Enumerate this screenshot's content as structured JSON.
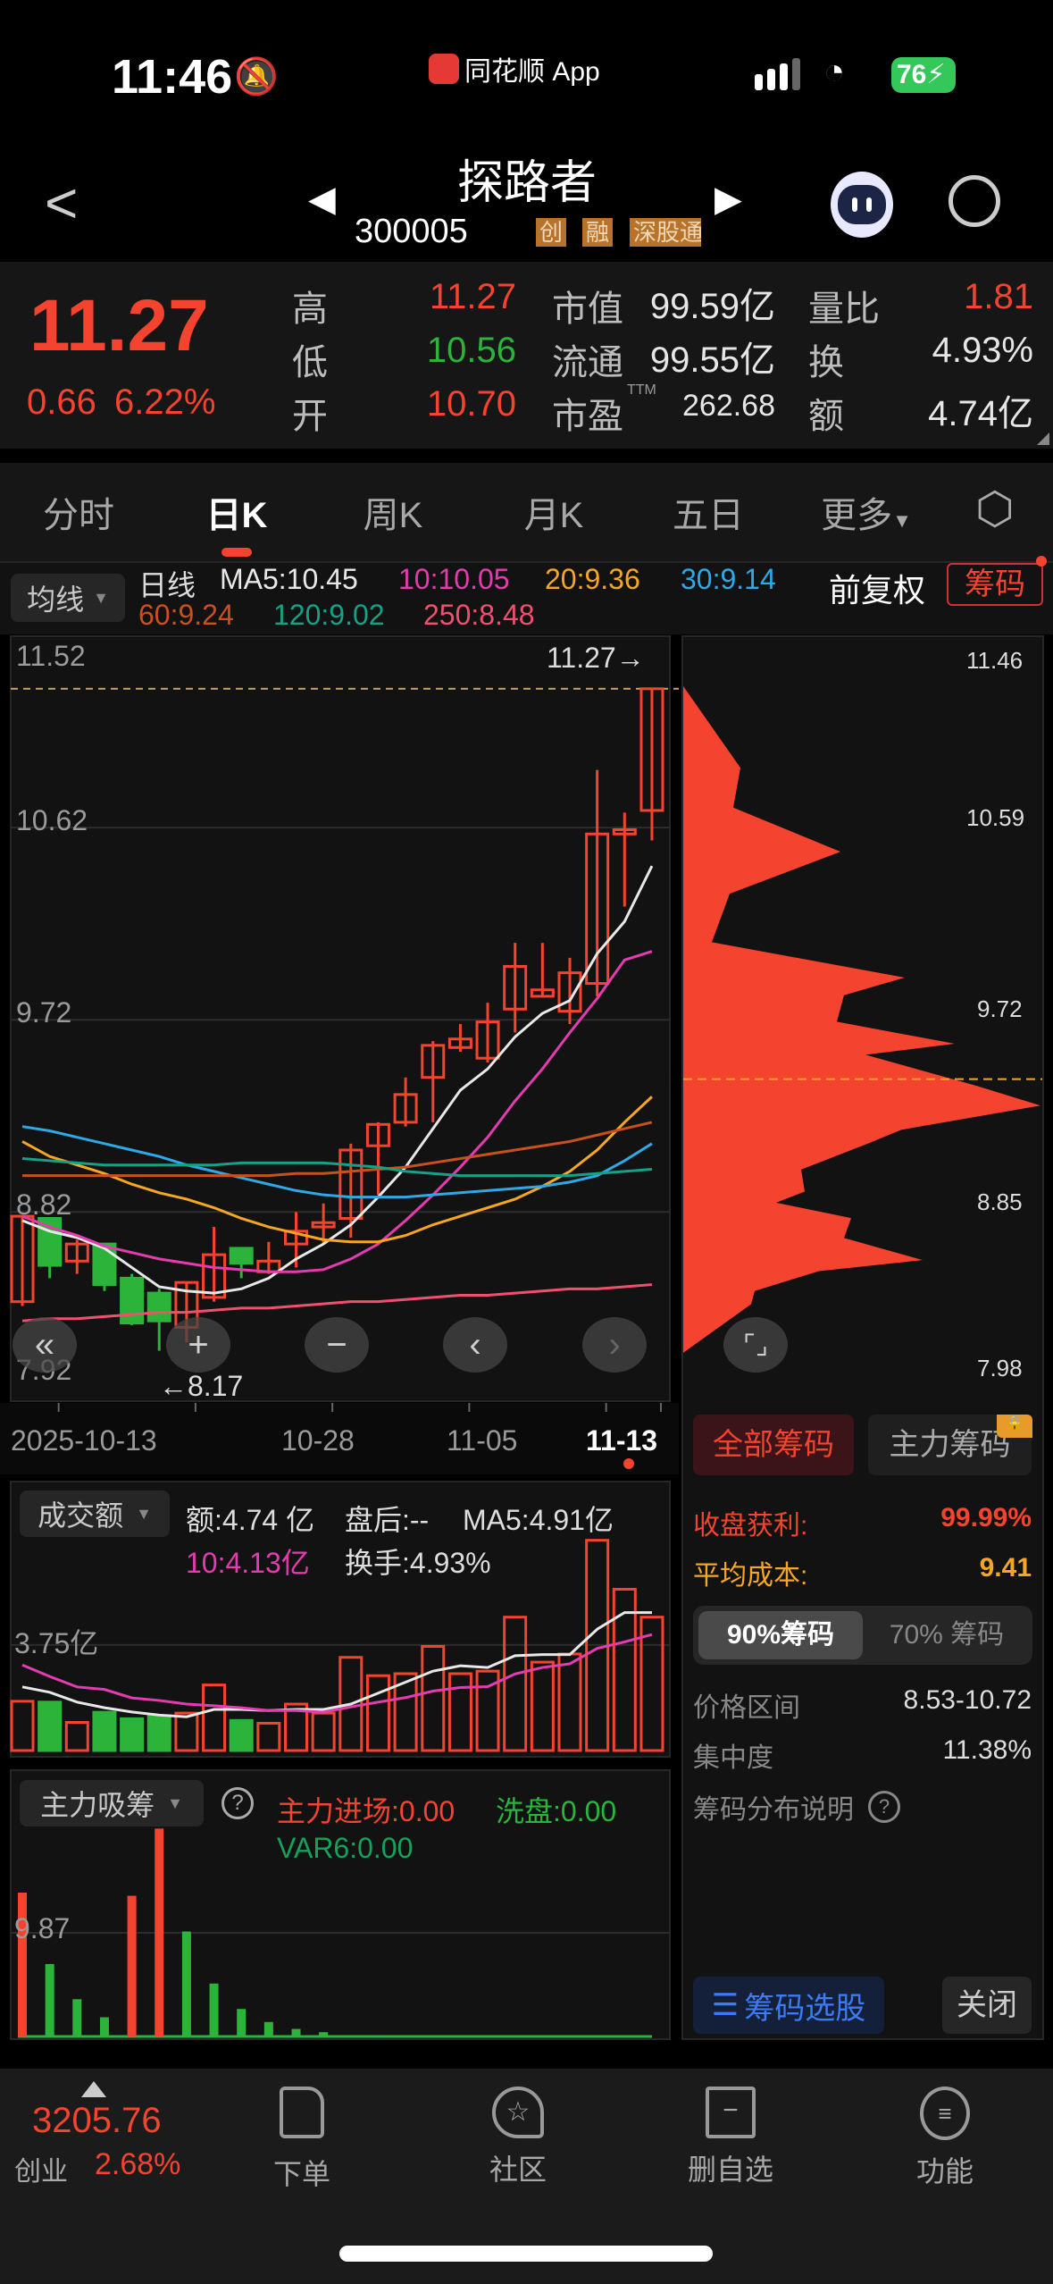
{
  "status": {
    "time": "11:46",
    "app": "同花顺 App",
    "battery": "76"
  },
  "header": {
    "title": "探路者",
    "code": "300005",
    "badges": [
      "创",
      "融",
      "深股通"
    ]
  },
  "quote": {
    "price": "11.27",
    "change": "0.66",
    "change_pct": "6.22%",
    "high_label": "高",
    "high": "11.27",
    "low_label": "低",
    "low": "10.56",
    "open_label": "开",
    "open": "10.70",
    "mcap_label": "市值",
    "mcap": "99.59亿",
    "float_label": "流通",
    "float": "99.55亿",
    "pe_label": "市盈",
    "pe_sup": "TTM",
    "pe": "262.68",
    "vr_label": "量比",
    "vr": "1.81",
    "turn_label": "换",
    "turn": "4.93%",
    "amt_label": "额",
    "amt": "4.74亿"
  },
  "tabs": [
    "分时",
    "日K",
    "周K",
    "月K",
    "五日",
    "更多"
  ],
  "legend": {
    "selector": "均线",
    "period": "日线",
    "ma5": "MA5:10.45",
    "ma10": "10:10.05",
    "ma20": "20:9.36",
    "ma30": "30:9.14",
    "ma60": "60:9.24",
    "ma120": "120:9.02",
    "ma250": "250:8.48",
    "adjust": "前复权",
    "chips": "筹码"
  },
  "colors": {
    "up": "#f4432f",
    "down": "#2bb33a",
    "ma5": "#e8e8e8",
    "ma10": "#e43cb0",
    "ma20": "#f5a623",
    "ma30": "#2fa8e8",
    "ma60": "#c8501e",
    "ma120": "#17a085",
    "ma250": "#f0506e"
  },
  "chart_data": [
    {
      "type": "candlestick",
      "title": "日K",
      "yticks": [
        "11.52",
        "10.62",
        "9.72",
        "8.82",
        "7.92"
      ],
      "ylim": [
        7.92,
        11.52
      ],
      "last_label": "11.27→",
      "low_label": "←8.17",
      "xticks": [
        "2025-10-13",
        "10-28",
        "11-05",
        "11-13"
      ],
      "ohlc": [
        [
          8.4,
          8.8,
          8.38,
          8.8
        ],
        [
          8.79,
          8.79,
          8.51,
          8.57
        ],
        [
          8.59,
          8.69,
          8.53,
          8.67
        ],
        [
          8.67,
          8.67,
          8.45,
          8.48
        ],
        [
          8.51,
          8.53,
          8.29,
          8.3
        ],
        [
          8.44,
          8.46,
          8.17,
          8.31
        ],
        [
          8.28,
          8.49,
          8.21,
          8.49
        ],
        [
          8.42,
          8.75,
          8.4,
          8.62
        ],
        [
          8.65,
          8.65,
          8.51,
          8.58
        ],
        [
          8.54,
          8.68,
          8.53,
          8.59
        ],
        [
          8.67,
          8.82,
          8.56,
          8.73
        ],
        [
          8.75,
          8.86,
          8.67,
          8.77
        ],
        [
          8.79,
          9.14,
          8.7,
          9.11
        ],
        [
          9.13,
          9.24,
          8.9,
          9.23
        ],
        [
          9.24,
          9.45,
          9.22,
          9.37
        ],
        [
          9.45,
          9.62,
          9.24,
          9.6
        ],
        [
          9.59,
          9.7,
          9.57,
          9.63
        ],
        [
          9.54,
          9.8,
          9.52,
          9.71
        ],
        [
          9.77,
          10.08,
          9.66,
          9.97
        ],
        [
          9.83,
          10.08,
          9.83,
          9.86
        ],
        [
          9.76,
          10.01,
          9.7,
          9.94
        ],
        [
          9.89,
          10.89,
          9.83,
          10.59
        ],
        [
          10.59,
          10.69,
          10.25,
          10.61
        ],
        [
          10.7,
          11.27,
          10.56,
          11.27
        ]
      ],
      "ma": {
        "ma5": [
          8.78,
          8.73,
          8.7,
          8.65,
          8.56,
          8.47,
          8.45,
          8.44,
          8.46,
          8.51,
          8.6,
          8.67,
          8.76,
          8.89,
          9.03,
          9.21,
          9.39,
          9.49,
          9.64,
          9.75,
          9.81,
          10.03,
          10.18,
          10.44
        ],
        "ma10": [
          8.8,
          8.75,
          8.71,
          8.66,
          8.63,
          8.6,
          8.58,
          8.56,
          8.55,
          8.54,
          8.54,
          8.55,
          8.6,
          8.67,
          8.78,
          8.9,
          9.03,
          9.17,
          9.34,
          9.49,
          9.66,
          9.82,
          10.0,
          10.04
        ],
        "ma20": [
          9.15,
          9.08,
          9.04,
          9.0,
          8.95,
          8.91,
          8.88,
          8.84,
          8.79,
          8.75,
          8.72,
          8.69,
          8.68,
          8.68,
          8.71,
          8.76,
          8.8,
          8.84,
          8.88,
          8.94,
          9.01,
          9.11,
          9.24,
          9.36
        ],
        "ma30": [
          9.22,
          9.2,
          9.17,
          9.14,
          9.11,
          9.08,
          9.04,
          9.01,
          8.98,
          8.95,
          8.92,
          8.9,
          8.89,
          8.89,
          8.89,
          8.9,
          8.91,
          8.92,
          8.93,
          8.94,
          8.96,
          8.99,
          9.06,
          9.14
        ],
        "ma60": [
          8.99,
          8.99,
          8.99,
          8.99,
          8.99,
          8.99,
          8.99,
          8.99,
          8.99,
          8.99,
          9.0,
          9.0,
          9.01,
          9.02,
          9.03,
          9.05,
          9.07,
          9.09,
          9.11,
          9.13,
          9.15,
          9.18,
          9.21,
          9.24
        ],
        "ma120": [
          9.07,
          9.06,
          9.05,
          9.04,
          9.04,
          9.04,
          9.04,
          9.04,
          9.05,
          9.05,
          9.05,
          9.05,
          9.04,
          9.03,
          9.01,
          9.0,
          8.99,
          8.99,
          8.99,
          8.99,
          8.99,
          9.0,
          9.01,
          9.02
        ],
        "ma250": [
          8.31,
          8.32,
          8.32,
          8.33,
          8.34,
          8.35,
          8.35,
          8.36,
          8.37,
          8.37,
          8.38,
          8.39,
          8.4,
          8.4,
          8.41,
          8.42,
          8.43,
          8.43,
          8.44,
          8.45,
          8.46,
          8.46,
          8.47,
          8.48
        ]
      }
    },
    {
      "type": "bar",
      "title": "成交额",
      "unit": "亿",
      "ytick": "3.75亿",
      "ytick_value": 3.75,
      "values": [
        1.75,
        1.72,
        1.0,
        1.36,
        1.13,
        1.23,
        1.33,
        2.33,
        1.07,
        0.97,
        1.65,
        1.33,
        3.31,
        2.66,
        2.73,
        3.7,
        2.73,
        2.82,
        4.74,
        3.14,
        3.43,
        7.47,
        5.73,
        4.74
      ],
      "down_idx": [
        1,
        3,
        4,
        5,
        8
      ],
      "ma5": [
        2.26,
        2.07,
        1.72,
        1.52,
        1.37,
        1.26,
        1.2,
        1.46,
        1.46,
        1.42,
        1.46,
        1.46,
        1.65,
        2.04,
        2.43,
        2.82,
        3.01,
        2.95,
        3.37,
        3.41,
        3.41,
        4.31,
        4.9,
        4.9
      ],
      "ma10": [
        3.04,
        2.63,
        2.26,
        2.17,
        1.87,
        1.78,
        1.65,
        1.59,
        1.52,
        1.42,
        1.42,
        1.36,
        1.55,
        1.72,
        1.88,
        2.11,
        2.24,
        2.27,
        2.72,
        2.95,
        3.08,
        3.63,
        3.86,
        4.12
      ]
    },
    {
      "type": "bar",
      "title": "主力吸筹",
      "ytick": "9.87",
      "ytick_value": 9.87,
      "values": [
        13.7,
        6.9,
        3.55,
        1.83,
        13.4,
        19.8,
        10.0,
        5.04,
        2.62,
        1.38,
        0.72,
        0.41,
        0.1,
        0.05,
        0,
        0,
        0,
        0,
        0,
        0,
        0,
        0,
        0,
        0
      ],
      "up_idx": [
        0,
        4,
        5
      ]
    },
    {
      "type": "histogram",
      "title": "筹码分布",
      "yticks": [
        "11.46",
        "10.59",
        "9.72",
        "8.85",
        "7.98"
      ],
      "avg_cost": 9.41,
      "profile": [
        [
          11.19,
          0
        ],
        [
          10.82,
          16
        ],
        [
          10.64,
          14
        ],
        [
          10.44,
          44
        ],
        [
          10.25,
          13
        ],
        [
          10.03,
          8
        ],
        [
          9.87,
          62
        ],
        [
          9.79,
          45
        ],
        [
          9.67,
          43
        ],
        [
          9.57,
          76
        ],
        [
          9.52,
          51
        ],
        [
          9.38,
          82
        ],
        [
          9.29,
          100
        ],
        [
          9.18,
          61
        ],
        [
          9.12,
          52
        ],
        [
          9.0,
          33
        ],
        [
          8.9,
          34
        ],
        [
          8.85,
          26
        ],
        [
          8.78,
          47
        ],
        [
          8.69,
          45
        ],
        [
          8.59,
          67
        ],
        [
          8.54,
          38
        ],
        [
          8.45,
          20
        ],
        [
          8.39,
          19
        ],
        [
          8.17,
          0
        ]
      ]
    }
  ],
  "volume_legend": {
    "selector": "成交额",
    "amt": "额:4.74 亿",
    "after": "盘后:--",
    "ma5": "MA5:4.91亿",
    "ma10": "10:4.13亿",
    "turn": "换手:4.93%"
  },
  "ind_legend": {
    "selector": "主力吸筹",
    "enter": "主力进场:0.00",
    "wash": "洗盘:0.00",
    "var6": "VAR6:0.00"
  },
  "chips": {
    "all": "全部筹码",
    "main": "主力筹码",
    "profit_label": "收盘获利:",
    "profit": "99.99%",
    "cost_label": "平均成本:",
    "cost": "9.41",
    "seg90": "90%筹码",
    "seg70": "70% 筹码",
    "range_label": "价格区间",
    "range": "8.53-10.72",
    "conc_label": "集中度",
    "conc": "11.38%",
    "help": "筹码分布说明",
    "select": "筹码选股",
    "close": "关闭"
  },
  "bottom": {
    "index_value": "3205.76",
    "index_name": "创业",
    "index_pct": "2.68%",
    "items": [
      "下单",
      "社区",
      "删自选",
      "功能"
    ]
  }
}
